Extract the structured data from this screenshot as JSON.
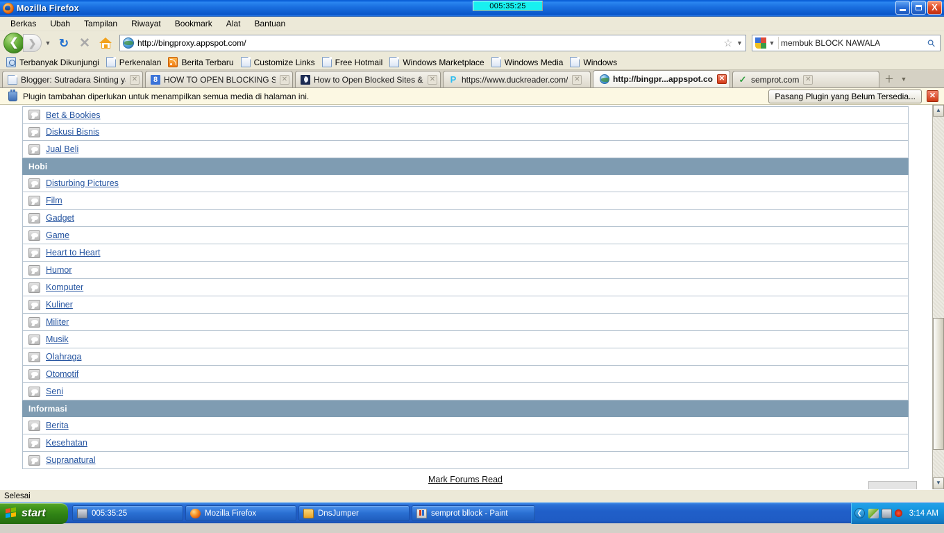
{
  "window": {
    "title": "Mozilla Firefox",
    "timer_overlay": "005:35:25",
    "minimize_label": "Minimize",
    "restore_label": "Restore",
    "close_label": "X"
  },
  "menubar": {
    "items": [
      {
        "label": "Berkas"
      },
      {
        "label": "Ubah"
      },
      {
        "label": "Tampilan"
      },
      {
        "label": "Riwayat"
      },
      {
        "label": "Bookmark"
      },
      {
        "label": "Alat"
      },
      {
        "label": "Bantuan"
      }
    ]
  },
  "toolbar": {
    "back_glyph": "❮",
    "forward_glyph": "❯",
    "dropdown_glyph": "▼",
    "reload_glyph": "↻",
    "stop_glyph": "✕",
    "url_value": "http://bingproxy.appspot.com/",
    "star_glyph": "☆",
    "url_dropdown_glyph": "▼",
    "search_value": "membuk BLOCK NAWALA",
    "search_dropdown_glyph": "▼",
    "magnifier_glyph": "⚲"
  },
  "bookmarks": {
    "items": [
      {
        "label": "Terbanyak Dikunjungi",
        "icon": "folder-magnifier-icon"
      },
      {
        "label": "Perkenalan",
        "icon": "page-icon"
      },
      {
        "label": "Berita Terbaru",
        "icon": "rss-icon"
      },
      {
        "label": "Customize Links",
        "icon": "page-icon"
      },
      {
        "label": "Free Hotmail",
        "icon": "page-icon"
      },
      {
        "label": "Windows Marketplace",
        "icon": "page-icon"
      },
      {
        "label": "Windows Media",
        "icon": "page-icon"
      },
      {
        "label": "Windows",
        "icon": "page-icon"
      }
    ]
  },
  "tabs": {
    "items": [
      {
        "title": "Blogger: Sutradara Sinting yang ...",
        "favicon": "page-icon",
        "active": false,
        "close_glyph": "✕"
      },
      {
        "title": "HOW TO OPEN BLOCKING SITE ...",
        "favicon": "google-icon",
        "active": false,
        "close_glyph": "✕"
      },
      {
        "title": "How to Open Blocked Sites & Un...",
        "favicon": "moon-icon",
        "active": false,
        "close_glyph": "✕"
      },
      {
        "title": "https://www.duckreader.com/",
        "favicon": "photobucket-icon",
        "active": false,
        "close_glyph": "✕"
      },
      {
        "title": "http://bingpr...appspot.com/",
        "favicon": "globe-icon",
        "active": true,
        "close_glyph": "✕"
      },
      {
        "title": "semprot.com",
        "favicon": "checkmark-icon",
        "active": false,
        "close_glyph": "✕"
      }
    ],
    "new_tab_glyph": "＋",
    "tab_list_glyph": "▼"
  },
  "notification": {
    "message": "Plugin tambahan diperlukan untuk menampilkan semua media di halaman ini.",
    "button_label": "Pasang Plugin yang Belum Tersedia...",
    "close_glyph": "✕"
  },
  "page": {
    "sections": [
      {
        "header": null,
        "forums": [
          "Bet & Bookies",
          "Diskusi Bisnis",
          "Jual Beli"
        ]
      },
      {
        "header": "Hobi",
        "forums": [
          "Disturbing Pictures",
          "Film",
          "Gadget",
          "Game",
          "Heart to Heart",
          "Humor",
          "Komputer",
          "Kuliner",
          "Militer",
          "Musik",
          "Olahraga",
          "Otomotif",
          "Seni"
        ]
      },
      {
        "header": "Informasi",
        "forums": [
          "Berita",
          "Kesehatan",
          "Supranatural"
        ]
      }
    ],
    "mark_forums_read": "Mark Forums Read",
    "scroll_up_glyph": "▲",
    "scroll_down_glyph": "▼"
  },
  "statusbar": {
    "text": "Selesai"
  },
  "taskbar": {
    "start_label": "start",
    "tasks": [
      {
        "label": "005:35:25",
        "icon": "timer-icon"
      },
      {
        "label": "Mozilla Firefox",
        "icon": "firefox-icon"
      },
      {
        "label": "DnsJumper",
        "icon": "folder-icon"
      },
      {
        "label": "semprot bllock - Paint",
        "icon": "paint-icon"
      }
    ],
    "tray_arrow_glyph": "❮",
    "clock": "3:14 AM"
  },
  "colors": {
    "section_header_bg": "#7f9cb2",
    "link": "#2554a0",
    "titlebar_blue": "#1a6fe0",
    "timer_cyan": "#18f0f0",
    "notification_bg": "#fcf8e3"
  }
}
